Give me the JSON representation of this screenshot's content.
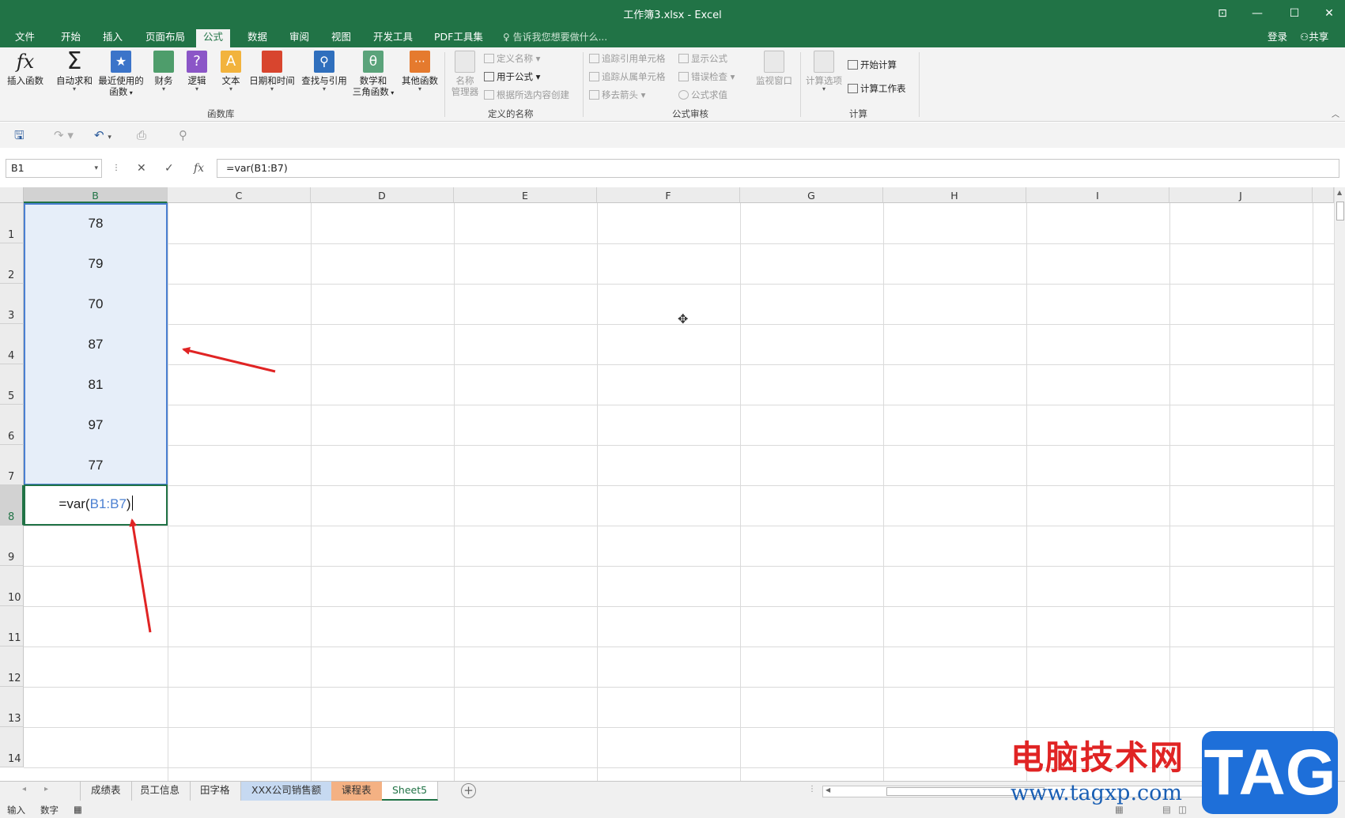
{
  "window": {
    "title": "工作簿3.xlsx - Excel",
    "controls": [
      "⊡",
      "—",
      "☐",
      "✕"
    ]
  },
  "tabs": [
    "文件",
    "开始",
    "插入",
    "页面布局",
    "公式",
    "数据",
    "审阅",
    "视图",
    "开发工具",
    "PDF工具集"
  ],
  "active_tab": "公式",
  "tell_me": "告诉我您想要做什么...",
  "login": "登录",
  "share": "共享",
  "ribbon": {
    "function_library": {
      "label": "函数库",
      "buttons": [
        {
          "label": "插入函数",
          "icon": "fx-icon"
        },
        {
          "label": "自动求和",
          "icon": "sigma-icon"
        },
        {
          "label": "最近使用的",
          "label2": "函数",
          "icon": "star-book-icon"
        },
        {
          "label": "财务",
          "icon": "finance-book-icon"
        },
        {
          "label": "逻辑",
          "icon": "question-book-icon"
        },
        {
          "label": "文本",
          "icon": "text-book-icon"
        },
        {
          "label": "日期和时间",
          "icon": "calendar-book-icon"
        },
        {
          "label": "查找与引用",
          "icon": "search-book-icon"
        },
        {
          "label": "数学和",
          "label2": "三角函数",
          "icon": "theta-book-icon"
        },
        {
          "label": "其他函数",
          "icon": "more-book-icon"
        }
      ]
    },
    "defined_names": {
      "label": "定义的名称",
      "name_manager": "名称",
      "name_manager2": "管理器",
      "define_name": "定义名称",
      "use_in_formula": "用于公式",
      "create_from_selection": "根据所选内容创建"
    },
    "formula_auditing": {
      "label": "公式审核",
      "trace_precedents": "追踪引用单元格",
      "trace_dependents": "追踪从属单元格",
      "remove_arrows": "移去箭头",
      "show_formulas": "显示公式",
      "error_checking": "错误检查",
      "evaluate_formula": "公式求值",
      "watch_window": "监视窗口"
    },
    "calculation": {
      "label": "计算",
      "options": "计算选项",
      "calc_now": "开始计算",
      "calc_sheet": "计算工作表"
    }
  },
  "formula_bar": {
    "name_box": "B1",
    "formula": "=var(B1:B7)"
  },
  "columns": [
    "B",
    "C",
    "D",
    "E",
    "F",
    "G",
    "H",
    "I",
    "J"
  ],
  "rows": [
    "1",
    "2",
    "3",
    "4",
    "5",
    "6",
    "7",
    "8",
    "9",
    "10",
    "11",
    "12",
    "13",
    "14"
  ],
  "cells_b": [
    "78",
    "79",
    "70",
    "87",
    "81",
    "97",
    "77"
  ],
  "editing_cell": {
    "prefix": "=var(",
    "ref": "B1:B7",
    "suffix": ")"
  },
  "sheet_tabs": [
    {
      "label": "成绩表",
      "style": "normal"
    },
    {
      "label": "员工信息",
      "style": "normal"
    },
    {
      "label": "田字格",
      "style": "normal"
    },
    {
      "label": "XXX公司销售额",
      "style": "blue"
    },
    {
      "label": "课程表",
      "style": "orange"
    },
    {
      "label": "Sheet5",
      "style": "active"
    }
  ],
  "status": {
    "mode": "输入",
    "numlock": "数字"
  },
  "watermark": {
    "text": "电脑技术网",
    "url": "www.tagxp.com",
    "tag": "TAG"
  },
  "colors": {
    "excel_green": "#217346",
    "selection_blue": "#4a7fd1",
    "arrow_red": "#e02424"
  }
}
